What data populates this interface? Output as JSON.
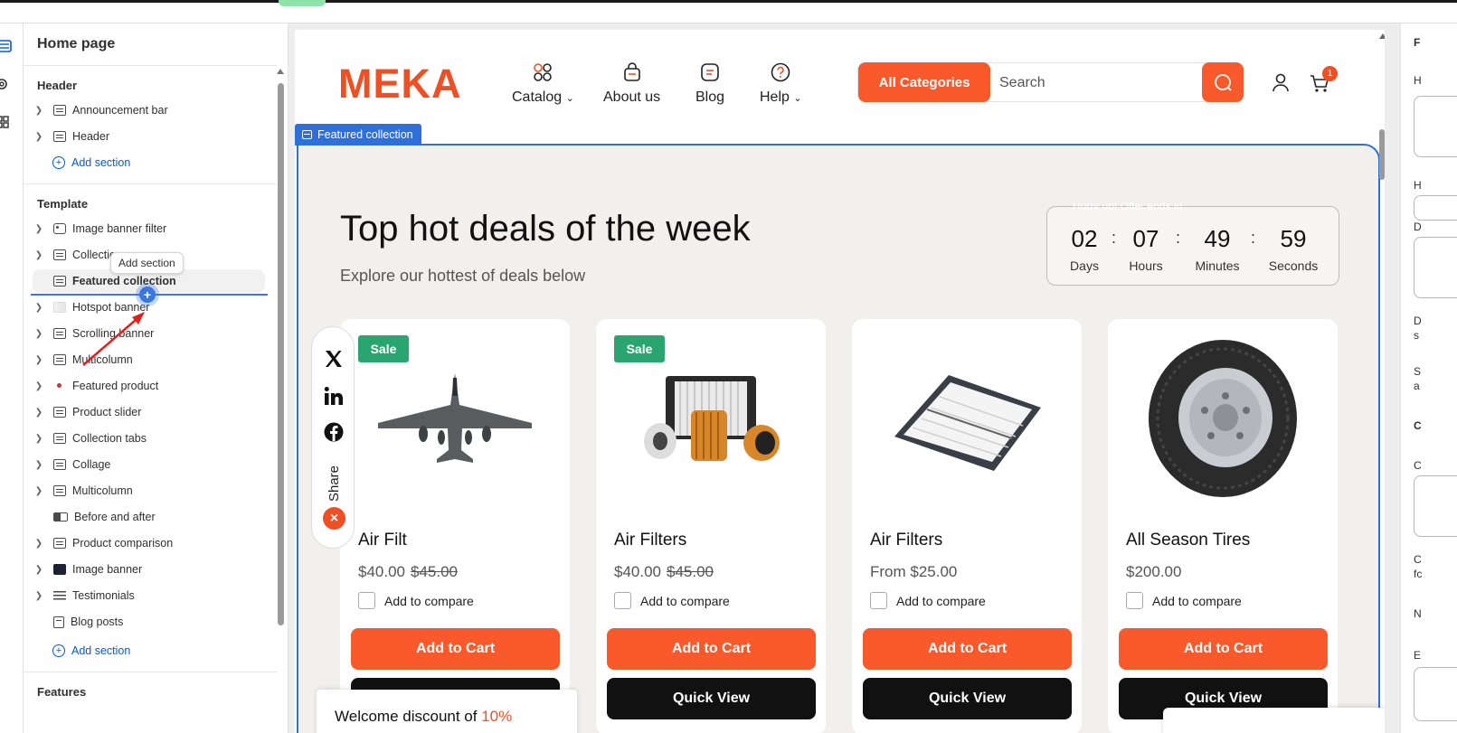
{
  "colors": {
    "accent": "#fa5a2b",
    "brand": "#f04e23",
    "editor_blue": "#2f6fd9",
    "sale_green": "#2ba56f",
    "link_blue": "#005bd3"
  },
  "sidebar": {
    "title": "Home page",
    "header_group": {
      "title": "Header",
      "items": [
        {
          "label": "Announcement bar",
          "icon": "section-icon"
        },
        {
          "label": "Header",
          "icon": "section-icon"
        }
      ],
      "add_label": "Add section"
    },
    "template_group": {
      "title": "Template",
      "items": [
        {
          "label": "Image banner filter",
          "icon": "image-icon"
        },
        {
          "label": "Collection",
          "icon": "section-icon"
        },
        {
          "label": "Featured collection",
          "icon": "section-icon",
          "selected": true
        },
        {
          "label": "Hotspot banner",
          "icon": "thumbnail-icon"
        },
        {
          "label": "Scrolling banner",
          "icon": "section-icon"
        },
        {
          "label": "Multicolumn",
          "icon": "section-icon"
        },
        {
          "label": "Featured product",
          "icon": "thumbnail-icon"
        },
        {
          "label": "Product slider",
          "icon": "section-icon"
        },
        {
          "label": "Collection tabs",
          "icon": "section-icon"
        },
        {
          "label": "Collage",
          "icon": "section-icon"
        },
        {
          "label": "Multicolumn",
          "icon": "section-icon"
        },
        {
          "label": "Before and after",
          "icon": "before-after-icon"
        },
        {
          "label": "Product comparison",
          "icon": "section-icon"
        },
        {
          "label": "Image banner",
          "icon": "thumbnail-icon"
        },
        {
          "label": "Testimonials",
          "icon": "list-icon"
        },
        {
          "label": "Blog posts",
          "icon": "blog-icon"
        }
      ],
      "add_label": "Add section"
    },
    "features_group": {
      "title": "Features"
    },
    "tooltip": "Add section",
    "drop_plus": "+"
  },
  "store": {
    "logo": "MEKA",
    "nav": [
      {
        "label": "Catalog",
        "icon": "grid-icon",
        "dropdown": true
      },
      {
        "label": "About us",
        "icon": "bag-icon",
        "dropdown": false
      },
      {
        "label": "Blog",
        "icon": "chat-icon",
        "dropdown": false
      },
      {
        "label": "Help",
        "icon": "question-icon",
        "dropdown": true
      }
    ],
    "all_categories": "All Categories",
    "search_placeholder": "Search",
    "cart_count": "1"
  },
  "section_tag": "Featured collection",
  "deals": {
    "title": "Top hot deals of the week",
    "subtitle": "Explore our hottest of deals below",
    "timer_caption": "Hurry up! Offer ends in",
    "timer": [
      {
        "value": "02",
        "unit": "Days"
      },
      {
        "value": "07",
        "unit": "Hours"
      },
      {
        "value": "49",
        "unit": "Minutes"
      },
      {
        "value": "59",
        "unit": "Seconds"
      }
    ],
    "timer_sep": ":"
  },
  "products": [
    {
      "name": "Air Filt",
      "price": "$40.00",
      "compare_price": "$45.00",
      "sale": "Sale",
      "image": "fighter-jet-image"
    },
    {
      "name": "Air Filters",
      "price": "$40.00",
      "compare_price": "$45.00",
      "sale": "Sale",
      "image": "oil-filters-image"
    },
    {
      "name": "Air Filters",
      "price": "From $25.00",
      "compare_price": "",
      "sale": "",
      "image": "panel-air-filter-image"
    },
    {
      "name": "All Season Tires",
      "price": "$200.00",
      "compare_price": "",
      "sale": "",
      "image": "tire-image"
    }
  ],
  "product_labels": {
    "compare": "Add to compare",
    "add_to_cart": "Add to Cart",
    "quick_view": "Quick View"
  },
  "share": {
    "label": "Share",
    "icons": [
      "x-icon",
      "linkedin-icon",
      "facebook-icon"
    ],
    "close": "×"
  },
  "popup": {
    "text_start": "Welcome discount of ",
    "text_highlight": "10%"
  },
  "right_panel": {
    "labels": [
      "F",
      "H",
      "H",
      "D",
      "D",
      "s",
      "S",
      "a",
      "C",
      "C",
      "C",
      "fc",
      "N",
      "E"
    ]
  }
}
